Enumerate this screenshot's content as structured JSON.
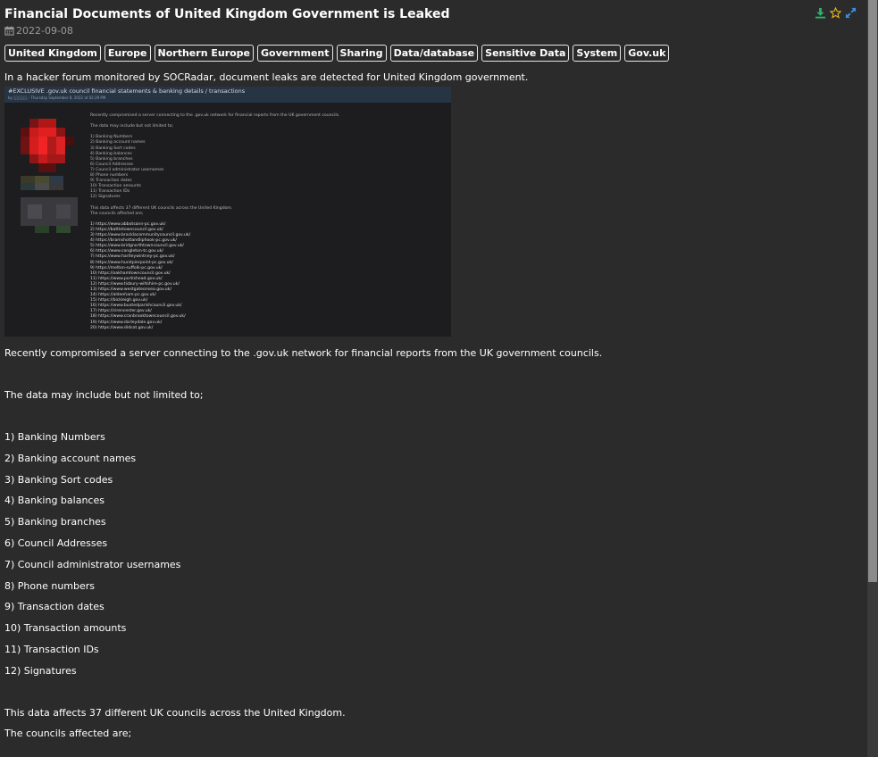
{
  "post": {
    "title": "Financial Documents of United Kingdom Government is Leaked",
    "date": "2022-09-08",
    "tags": [
      "United Kingdom",
      "Europe",
      "Northern Europe",
      "Government",
      "Sharing",
      "Data/database",
      "Sensitive Data",
      "System",
      "Gov.uk"
    ],
    "intro": "In a hacker forum monitored by SOCRadar, document leaks are detected for United Kingdom government.",
    "summary": "Recently compromised a server connecting to the .gov.uk network for financial reports from the UK government councils.",
    "may_include": "The data may include but not limited to;",
    "data_items": [
      "1) Banking Numbers",
      "2) Banking account names",
      "3) Banking Sort codes",
      "4) Banking balances",
      "5) Banking branches",
      "6) Council Addresses",
      "7) Council administrator usernames",
      "8) Phone numbers",
      "9) Transaction dates",
      "10) Transaction amounts",
      "11) Transaction IDs",
      "12) Signatures"
    ],
    "affects": "This data affects 37 different UK councils across the United Kingdom.",
    "councils_label": "The councils affected are;"
  },
  "screenshot": {
    "forum_title": "#EXCLUSIVE .gov.uk council financial statements & banking details / transactions",
    "forum_sub": "by ░░░░░ - Thursday September 8, 2022 at 02:29 PM",
    "post_lines": [
      "Recently compromised a server connecting to the .gov.uk network for financial reports from the UK government councils.",
      "",
      "The data may include but not limited to;",
      "",
      "1) Banking Numbers",
      "2) Banking account names",
      "3) Banking Sort codes",
      "4) Banking balances",
      "5) Banking branches",
      "6) Council Addresses",
      "7) Council administrator usernames",
      "8) Phone numbers",
      "9) Transaction dates",
      "10) Transaction amounts",
      "11) Transaction IDs",
      "12) Signatures",
      "",
      "This data affects 37 different UK councils across the United Kingdom.",
      "The councils affected are;",
      "",
      "1) https://www.abbotsann-pc.gov.uk/",
      "2) https://battletowncouncil.gov.uk/",
      "3) https://www.bracklacommunitycouncil.gov.uk/",
      "4) https://bramshottandliphook-pc.gov.uk/",
      "5) https://www.bridgnorthtowncouncil.gov.uk/",
      "6) https://www.congleton-tc.gov.uk/",
      "7) https://www.hartleywintney-pc.gov.uk/",
      "8) https://www.hurstpierpoint-pc.gov.uk/",
      "9) https://melton-suffolk-pc.gov.uk/",
      "10) https://oakhamtowncouncil.gov.uk/",
      "11) https://www.portishead.gov.uk/",
      "12) https://www.tisbury-wiltshire-pc.gov.uk/",
      "13) https://www.westgateonsea.gov.uk/",
      "14) https://aldenham-pc.gov.uk/",
      "15) https://bickleigh.gov.uk/",
      "16) https://www.buxtedparishcouncil.gov.uk/",
      "17) https://cirencester.gov.uk/",
      "18) https://www.cranbrooktowncouncil.gov.uk/",
      "19) https://www.darleydale.gov.uk/",
      "20) https://www.didcot.gov.uk/"
    ]
  },
  "icons": {
    "download": "download-icon",
    "star": "star-icon",
    "expand": "expand-icon",
    "calendar": "calendar-icon"
  },
  "colors": {
    "background": "#2b2b2b",
    "download_icon": "#2fb36b",
    "star_icon": "#e6b422",
    "expand_icon": "#3b8fe0",
    "date_text": "#9a9a9a"
  }
}
